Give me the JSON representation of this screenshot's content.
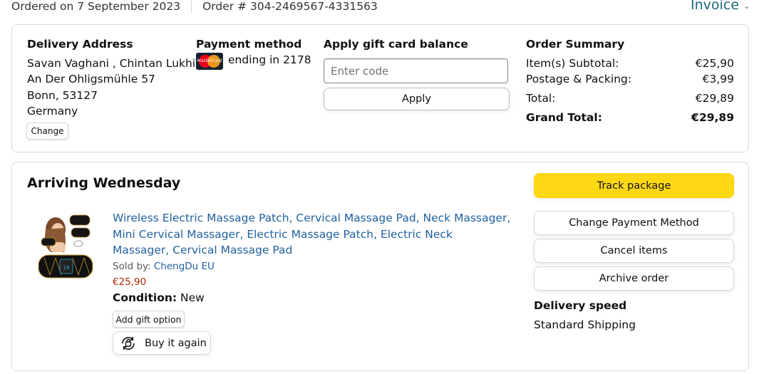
{
  "header": {
    "ordered_on": "Ordered on 7 September 2023",
    "order_number": "Order # 304-2469567-4331563",
    "invoice_label": "Invoice"
  },
  "delivery": {
    "heading": "Delivery Address",
    "lines": [
      "Savan Vaghani , Chintan Lukhi",
      "An Der Ohligsmühle 57",
      "Bonn, 53127",
      "Germany"
    ],
    "change_label": "Change"
  },
  "payment": {
    "heading": "Payment method",
    "card_brand_text": "MasterCard",
    "ending_text": "ending in 2178"
  },
  "gift_card": {
    "heading": "Apply gift card balance",
    "placeholder": "Enter code",
    "value": "",
    "apply_label": "Apply"
  },
  "summary": {
    "heading": "Order Summary",
    "items_label": "Item(s) Subtotal:",
    "items_value": "€25,90",
    "postage_label": "Postage & Packing:",
    "postage_value": "€3,99",
    "total_label": "Total:",
    "total_value": "€29,89",
    "grand_label": "Grand Total:",
    "grand_value": "€29,89"
  },
  "shipment": {
    "heading": "Arriving Wednesday",
    "product": {
      "title": "Wireless Electric Massage Patch, Cervical Massage Pad, Neck Massager, Mini Cervical Massager, Electric Massage Patch, Electric Neck Massager, Cervical Massage Pad",
      "sold_by_label": "Sold by:",
      "seller": "ChengDu EU",
      "price": "€25,90",
      "condition_label": "Condition:",
      "condition_value": "New",
      "gift_label": "Add gift option",
      "buy_again_label": "Buy it again"
    },
    "actions": {
      "track": "Track package",
      "change_payment": "Change Payment Method",
      "cancel": "Cancel items",
      "archive": "Archive order"
    },
    "delivery_speed_heading": "Delivery speed",
    "delivery_speed_value": "Standard Shipping"
  },
  "colors": {
    "link": "#2162a1",
    "price": "#b12704",
    "track_button": "#ffd814",
    "border": "#d5d9d9"
  }
}
